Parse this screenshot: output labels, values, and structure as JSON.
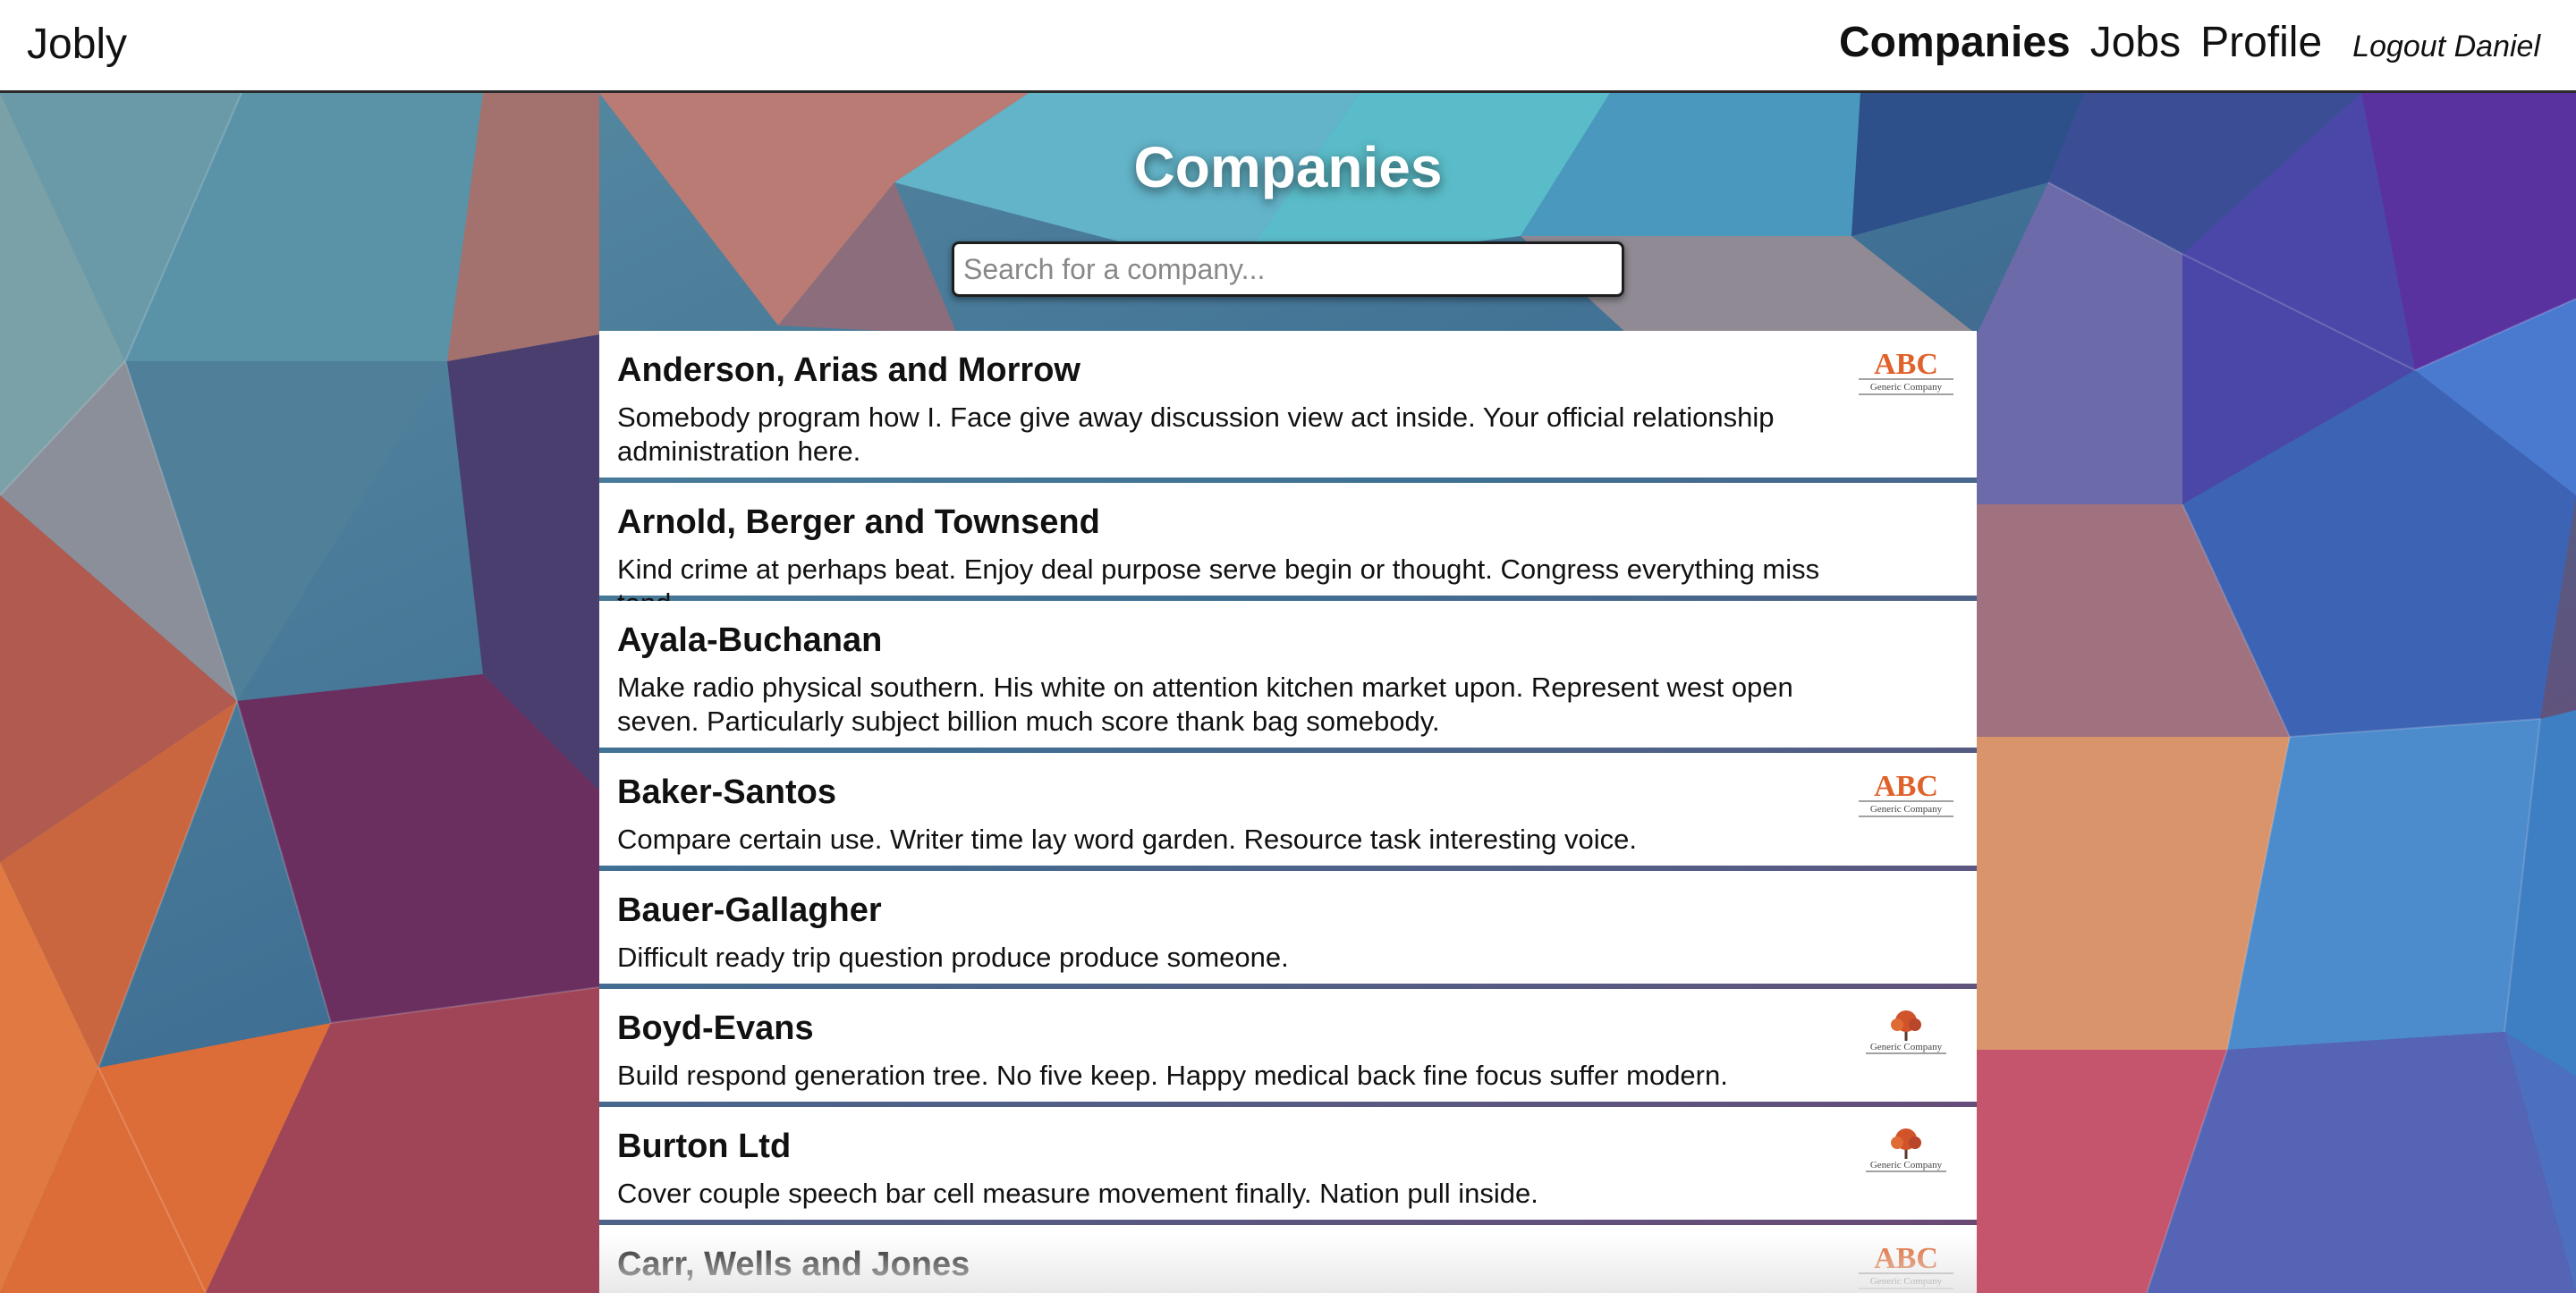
{
  "navbar": {
    "brand": "Jobly",
    "links": [
      {
        "label": "Companies",
        "active": true
      },
      {
        "label": "Jobs",
        "active": false
      },
      {
        "label": "Profile",
        "active": false
      }
    ],
    "logout_label": "Logout Daniel"
  },
  "page": {
    "title": "Companies",
    "search_placeholder": "Search for a company..."
  },
  "companies": [
    {
      "name": "Anderson, Arias and Morrow",
      "description": "Somebody program how I. Face give away discussion view act inside. Your official relationship administration here.",
      "logo": "abc-logo"
    },
    {
      "name": "Arnold, Berger and Townsend",
      "description": "Kind crime at perhaps beat. Enjoy deal purpose serve begin or thought. Congress everything miss tend.",
      "logo": ""
    },
    {
      "name": "Ayala-Buchanan",
      "description": "Make radio physical southern. His white on attention kitchen market upon. Represent west open seven. Particularly subject billion much score thank bag somebody.",
      "logo": ""
    },
    {
      "name": "Baker-Santos",
      "description": "Compare certain use. Writer time lay word garden. Resource task interesting voice.",
      "logo": "abc-logo"
    },
    {
      "name": "Bauer-Gallagher",
      "description": "Difficult ready trip question produce produce someone.",
      "logo": ""
    },
    {
      "name": "Boyd-Evans",
      "description": "Build respond generation tree. No five keep. Happy medical back fine focus suffer modern.",
      "logo": "tree-logo"
    },
    {
      "name": "Burton Ltd",
      "description": "Cover couple speech bar cell measure movement finally. Nation pull inside.",
      "logo": "tree-logo"
    },
    {
      "name": "Carr, Wells and Jones",
      "description": "",
      "logo": "abc-logo"
    }
  ],
  "logo_text": {
    "abc": "ABC",
    "generic": "Generic Company"
  },
  "colors": {
    "abc_logo": "#e0622b",
    "tree_logo": "#d0532a",
    "nav_border": "#2a2a2a"
  }
}
